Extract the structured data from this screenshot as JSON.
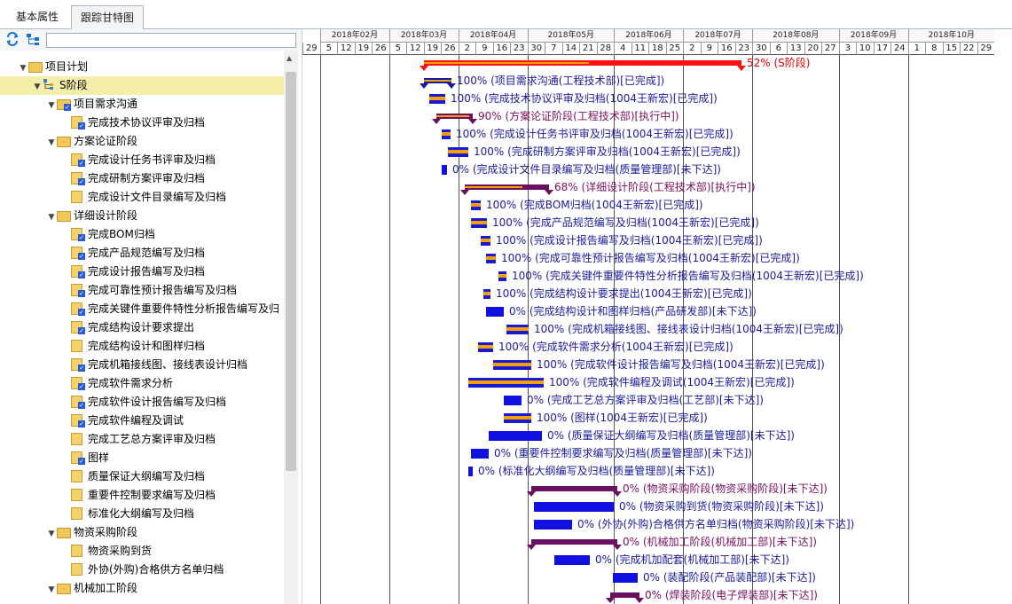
{
  "tabs": [
    {
      "label": "基本属性",
      "active": false
    },
    {
      "label": "跟踪甘特图",
      "active": true
    }
  ],
  "search": {
    "value": ""
  },
  "tree": [
    {
      "label": "项目计划",
      "level": 0,
      "arrow": "▼",
      "icon": "folder",
      "check": false
    },
    {
      "label": "S阶段",
      "level": 1,
      "arrow": "▼",
      "icon": "hierarchy",
      "check": false,
      "selected": true
    },
    {
      "label": "项目需求沟通",
      "level": 2,
      "arrow": "▼",
      "icon": "folder",
      "check": true
    },
    {
      "label": "完成技术协议评审及归档",
      "level": 3,
      "arrow": "",
      "icon": "doc",
      "check": true
    },
    {
      "label": "方案论证阶段",
      "level": 2,
      "arrow": "▼",
      "icon": "folder",
      "check": false
    },
    {
      "label": "完成设计任务书评审及归档",
      "level": 3,
      "arrow": "",
      "icon": "doc",
      "check": true
    },
    {
      "label": "完成研制方案评审及归档",
      "level": 3,
      "arrow": "",
      "icon": "doc",
      "check": true
    },
    {
      "label": "完成设计文件目录编写及归档",
      "level": 3,
      "arrow": "",
      "icon": "doc",
      "check": false
    },
    {
      "label": "详细设计阶段",
      "level": 2,
      "arrow": "▼",
      "icon": "folder",
      "check": false
    },
    {
      "label": "完成BOM归档",
      "level": 3,
      "arrow": "",
      "icon": "doc",
      "check": true
    },
    {
      "label": "完成产品规范编写及归档",
      "level": 3,
      "arrow": "",
      "icon": "doc",
      "check": true
    },
    {
      "label": "完成设计报告编写及归档",
      "level": 3,
      "arrow": "",
      "icon": "doc",
      "check": true
    },
    {
      "label": "完成可靠性预计报告编写及归档",
      "level": 3,
      "arrow": "",
      "icon": "doc",
      "check": true
    },
    {
      "label": "完成关键件重要件特性分析报告编写及归",
      "level": 3,
      "arrow": "",
      "icon": "doc",
      "check": true
    },
    {
      "label": "完成结构设计要求提出",
      "level": 3,
      "arrow": "",
      "icon": "doc",
      "check": true
    },
    {
      "label": "完成结构设计和图样归档",
      "level": 3,
      "arrow": "",
      "icon": "doc",
      "check": false
    },
    {
      "label": "完成机箱接线图、接线表设计归档",
      "level": 3,
      "arrow": "",
      "icon": "doc",
      "check": true
    },
    {
      "label": "完成软件需求分析",
      "level": 3,
      "arrow": "",
      "icon": "doc",
      "check": true
    },
    {
      "label": "完成软件设计报告编写及归档",
      "level": 3,
      "arrow": "",
      "icon": "doc",
      "check": true
    },
    {
      "label": "完成软件编程及调试",
      "level": 3,
      "arrow": "",
      "icon": "doc",
      "check": true
    },
    {
      "label": "完成工艺总方案评审及归档",
      "level": 3,
      "arrow": "",
      "icon": "doc",
      "check": false
    },
    {
      "label": "图样",
      "level": 3,
      "arrow": "",
      "icon": "doc",
      "check": true
    },
    {
      "label": "质量保证大纲编写及归档",
      "level": 3,
      "arrow": "",
      "icon": "doc",
      "check": false
    },
    {
      "label": "重要件控制要求编写及归档",
      "level": 3,
      "arrow": "",
      "icon": "doc",
      "check": false
    },
    {
      "label": "标准化大纲编写及归档",
      "level": 3,
      "arrow": "",
      "icon": "doc",
      "check": false
    },
    {
      "label": "物资采购阶段",
      "level": 2,
      "arrow": "▼",
      "icon": "folder",
      "check": false
    },
    {
      "label": "物资采购到货",
      "level": 3,
      "arrow": "",
      "icon": "doc",
      "check": false
    },
    {
      "label": "外协(外购)合格供方名单归档",
      "level": 3,
      "arrow": "",
      "icon": "doc",
      "check": false
    },
    {
      "label": "机械加工阶段",
      "level": 2,
      "arrow": "▼",
      "icon": "folder",
      "check": false
    }
  ],
  "months": [
    "2018年02月",
    "2018年03月",
    "2018年04月",
    "2018年05月",
    "2018年06月",
    "2018年07月",
    "2018年08月",
    "2018年09月",
    "2018年10月"
  ],
  "days": [
    "29",
    "5",
    "12",
    "19",
    "26",
    "5",
    "12",
    "19",
    "26",
    "2",
    "9",
    "16",
    "23",
    "30",
    "7",
    "14",
    "21",
    "28",
    "4",
    "11",
    "18",
    "25",
    "2",
    "9",
    "16",
    "23",
    "30",
    "6",
    "13",
    "20",
    "27",
    "3",
    "10",
    "17",
    "24",
    "1",
    "8",
    "15",
    "22",
    "29"
  ],
  "gantt": [
    {
      "kind": "summary",
      "start": 137,
      "end": 495,
      "progress": 52,
      "color": "red",
      "label": "52% (S阶段)",
      "tc": "#e00000"
    },
    {
      "kind": "summary",
      "start": 137,
      "end": 168,
      "progress": 100,
      "color": "navy",
      "label": "100% (项目需求沟通(工程技术部)[已完成])",
      "tc": "#1a1a9a"
    },
    {
      "kind": "task",
      "start": 143,
      "end": 161,
      "progress": 100,
      "label": "100% (完成技术协议评审及归档(1004王新宏)[已完成])",
      "tc": "#1a1a9a"
    },
    {
      "kind": "summary",
      "start": 151,
      "end": 192,
      "progress": 90,
      "color": "purple",
      "label": "90% (方案论证阶段(工程技术部)[执行中])",
      "tc": "#7a1060"
    },
    {
      "kind": "task",
      "start": 157,
      "end": 167,
      "progress": 100,
      "label": "100% (完成设计任务书评审及归档(1004王新宏)[已完成])",
      "tc": "#1a1a9a"
    },
    {
      "kind": "task",
      "start": 164,
      "end": 187,
      "progress": 100,
      "label": "100% (完成研制方案评审及归档(1004王新宏)[已完成])",
      "tc": "#1a1a9a"
    },
    {
      "kind": "task",
      "start": 157,
      "end": 163,
      "progress": 0,
      "label": "0% (完成设计文件目录编写及归档(质量管理部)[未下达])",
      "tc": "#1a1a9a"
    },
    {
      "kind": "summary",
      "start": 183,
      "end": 278,
      "progress": 68,
      "color": "purple",
      "label": "68% (详细设计阶段(工程技术部)[执行中])",
      "tc": "#7a1060"
    },
    {
      "kind": "task",
      "start": 190,
      "end": 201,
      "progress": 100,
      "label": "100% (完成BOM归档(1004王新宏)[已完成])",
      "tc": "#1a1a9a"
    },
    {
      "kind": "task",
      "start": 190,
      "end": 208,
      "progress": 100,
      "label": "100% (完成产品规范编写及归档(1004王新宏)[已完成])",
      "tc": "#1a1a9a"
    },
    {
      "kind": "task",
      "start": 201,
      "end": 212,
      "progress": 100,
      "label": "100% (完成设计报告编写及归档(1004王新宏)[已完成])",
      "tc": "#1a1a9a"
    },
    {
      "kind": "task",
      "start": 207,
      "end": 218,
      "progress": 100,
      "label": "100% (完成可靠性预计报告编写及归档(1004王新宏)[已完成])",
      "tc": "#1a1a9a"
    },
    {
      "kind": "task",
      "start": 221,
      "end": 230,
      "progress": 100,
      "label": "100% (完成关键件重要件特性分析报告编写及归档(1004王新宏)[已完成])",
      "tc": "#1a1a9a"
    },
    {
      "kind": "task",
      "start": 204,
      "end": 212,
      "progress": 100,
      "label": "100% (完成结构设计要求提出(1004王新宏)[已完成])",
      "tc": "#1a1a9a"
    },
    {
      "kind": "task",
      "start": 207,
      "end": 227,
      "progress": 0,
      "label": "0% (完成结构设计和图样归档(产品研发部)[未下达])",
      "tc": "#1a1a9a"
    },
    {
      "kind": "task",
      "start": 230,
      "end": 255,
      "progress": 100,
      "label": "100% (完成机箱接线图、接线表设计归档(1004王新宏)[已完成])",
      "tc": "#1a1a9a"
    },
    {
      "kind": "task",
      "start": 198,
      "end": 215,
      "progress": 100,
      "label": "100% (完成软件需求分析(1004王新宏)[已完成])",
      "tc": "#1a1a9a"
    },
    {
      "kind": "task",
      "start": 215,
      "end": 258,
      "progress": 100,
      "label": "100% (完成软件设计报告编写及归档(1004王新宏)[已完成])",
      "tc": "#1a1a9a"
    },
    {
      "kind": "task",
      "start": 187,
      "end": 272,
      "progress": 100,
      "label": "100% (完成软件编程及调试(1004王新宏)[已完成])",
      "tc": "#1a1a9a"
    },
    {
      "kind": "task",
      "start": 227,
      "end": 247,
      "progress": 0,
      "label": "0% (完成工艺总方案评审及归档(工艺部)[未下达])",
      "tc": "#1a1a9a"
    },
    {
      "kind": "task",
      "start": 227,
      "end": 258,
      "progress": 100,
      "label": "100% (图样(1004王新宏)[已完成])",
      "tc": "#1a1a9a"
    },
    {
      "kind": "task",
      "start": 210,
      "end": 270,
      "progress": 0,
      "label": "0% (质量保证大纲编写及归档(质量管理部)[未下达])",
      "tc": "#1a1a9a"
    },
    {
      "kind": "task",
      "start": 190,
      "end": 210,
      "progress": 0,
      "label": "0% (重要件控制要求编写及归档(质量管理部)[未下达])",
      "tc": "#1a1a9a"
    },
    {
      "kind": "task",
      "start": 187,
      "end": 192,
      "progress": 0,
      "label": "0% (标准化大纲编写及归档(质量管理部)[未下达])",
      "tc": "#1a1a9a"
    },
    {
      "kind": "summary",
      "start": 258,
      "end": 355,
      "progress": 0,
      "color": "purple",
      "label": "0% (物资采购阶段(物资采购阶段)[未下达])",
      "tc": "#7a1060"
    },
    {
      "kind": "task",
      "start": 261,
      "end": 351,
      "progress": 0,
      "label": "0% (物资采购到货(物资采购阶段)[未下达])",
      "tc": "#1a1a9a"
    },
    {
      "kind": "task",
      "start": 261,
      "end": 304,
      "progress": 0,
      "label": "0% (外协(外购)合格供方名单归档(物资采购阶段)[未下达])",
      "tc": "#1a1a9a"
    },
    {
      "kind": "summary",
      "start": 258,
      "end": 355,
      "progress": 0,
      "color": "purple",
      "label": "0% (机械加工阶段(机械加工部)[未下达])",
      "tc": "#7a1060"
    },
    {
      "kind": "task",
      "start": 284,
      "end": 324,
      "progress": 0,
      "label": "0% (完成机加配套(机械加工部)[未下达])",
      "tc": "#1a1a9a"
    },
    {
      "kind": "task",
      "start": 350,
      "end": 378,
      "progress": 0,
      "label": "0% (装配阶段(产品装配部)[未下达])",
      "tc": "#1a1a9a"
    },
    {
      "kind": "summary",
      "start": 347,
      "end": 380,
      "progress": 0,
      "color": "purple",
      "label": "0% (焊装阶段(电子焊装部)[未下达])",
      "tc": "#7a1060"
    }
  ]
}
